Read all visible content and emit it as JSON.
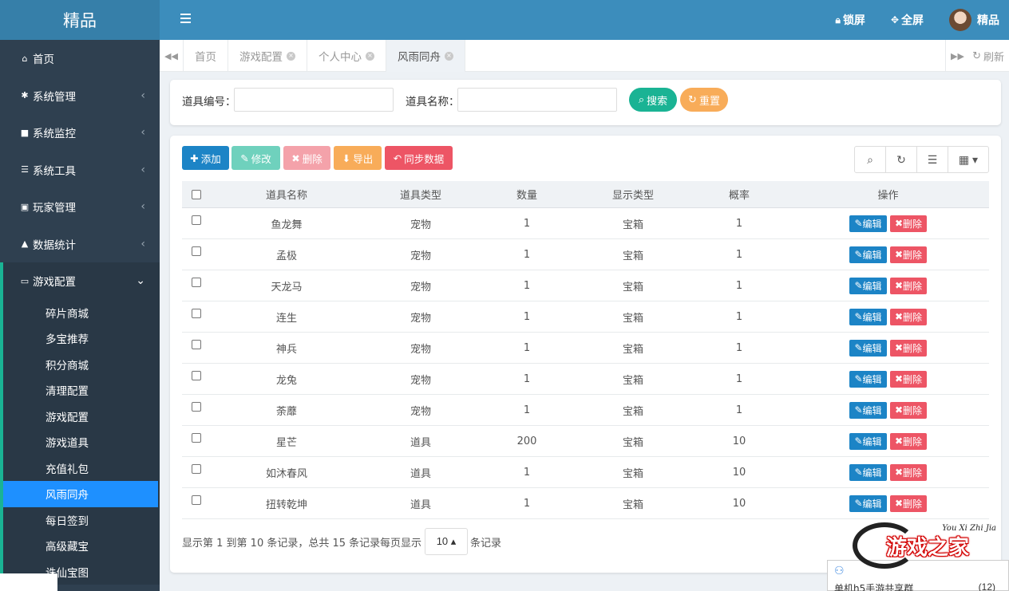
{
  "logo": "精品",
  "sidebar": {
    "items": [
      {
        "label": "首页",
        "icon": "home-icon",
        "glyph": "⌂"
      },
      {
        "label": "系统管理",
        "icon": "gear-icon",
        "glyph": "✱"
      },
      {
        "label": "系统监控",
        "icon": "video-camera-icon",
        "glyph": "■"
      },
      {
        "label": "系统工具",
        "icon": "bars-icon",
        "glyph": "☰"
      },
      {
        "label": "玩家管理",
        "icon": "user-card-icon",
        "glyph": "▣"
      },
      {
        "label": "数据统计",
        "icon": "area-chart-icon",
        "glyph": "▲"
      },
      {
        "label": "游戏配置",
        "icon": "desktop-icon",
        "glyph": "▭"
      }
    ],
    "arrow": "‹",
    "arrow_open": "⌄",
    "sub_items": [
      "碎片商城",
      "多宝推荐",
      "积分商城",
      "清理配置",
      "游戏配置",
      "游戏道具",
      "充值礼包",
      "风雨同舟",
      "每日签到",
      "高级藏宝",
      "诛仙宝图"
    ]
  },
  "topbar": {
    "lock": "锁屏",
    "fullscreen": "全屏",
    "user": "精品",
    "accent": "#3c8dbc"
  },
  "tabs": [
    "首页",
    "游戏配置",
    "个人中心",
    "风雨同舟"
  ],
  "tab_close": "×",
  "nav_left": "◀◀",
  "nav_right": "▶▶",
  "refresh_label": "刷新",
  "search": {
    "label1": "道具编号：",
    "label2": "道具名称：",
    "search_btn": "搜索",
    "reset_btn": "重置"
  },
  "toolbar": {
    "add": "添加",
    "edit": "修改",
    "delete": "删除",
    "export": "导出",
    "sync": "同步数据"
  },
  "table": {
    "headers": [
      "道具名称",
      "道具类型",
      "数量",
      "显示类型",
      "概率",
      "操作"
    ],
    "edit_label": "编辑",
    "delete_label": "删除",
    "rows": [
      [
        "鱼龙舞",
        "宠物",
        "1",
        "宝箱",
        "1"
      ],
      [
        "孟极",
        "宠物",
        "1",
        "宝箱",
        "1"
      ],
      [
        "天龙马",
        "宠物",
        "1",
        "宝箱",
        "1"
      ],
      [
        "连生",
        "宠物",
        "1",
        "宝箱",
        "1"
      ],
      [
        "神兵",
        "宠物",
        "1",
        "宝箱",
        "1"
      ],
      [
        "龙兔",
        "宠物",
        "1",
        "宝箱",
        "1"
      ],
      [
        "荼蘼",
        "宠物",
        "1",
        "宝箱",
        "1"
      ],
      [
        "星芒",
        "道具",
        "200",
        "宝箱",
        "10"
      ],
      [
        "如沐春风",
        "道具",
        "1",
        "宝箱",
        "10"
      ],
      [
        "扭转乾坤",
        "道具",
        "1",
        "宝箱",
        "10"
      ]
    ]
  },
  "pagination": {
    "summary": "显示第 1 到第 10 条记录，总共 15 条记录",
    "per_page_prefix": "每页显示",
    "page_size": "10 ▴",
    "per_page_suffix": "条记录"
  },
  "watermark": {
    "text": "游戏之家",
    "en": "You Xi Zhi Jia"
  },
  "qq_bar": {
    "title": "单机h5手游共享群",
    "count": "(12)"
  }
}
